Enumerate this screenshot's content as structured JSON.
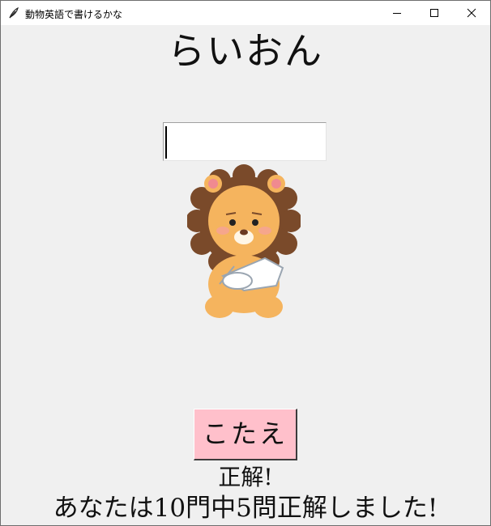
{
  "window": {
    "title": "動物英語で書けるかな",
    "icons": {
      "app": "feather-icon",
      "minimize": "minimize-icon",
      "maximize": "maximize-icon",
      "close": "close-icon"
    }
  },
  "quiz": {
    "word": "らいおん",
    "answer_value": "",
    "image": "lion-illustration",
    "button_label": "こたえ",
    "result_text": "正解!",
    "score_text": "あなたは10門中5問正解しました!"
  },
  "colors": {
    "background": "#f0f0f0",
    "button": "#ffc0cb",
    "titlebar": "#ffffff"
  }
}
